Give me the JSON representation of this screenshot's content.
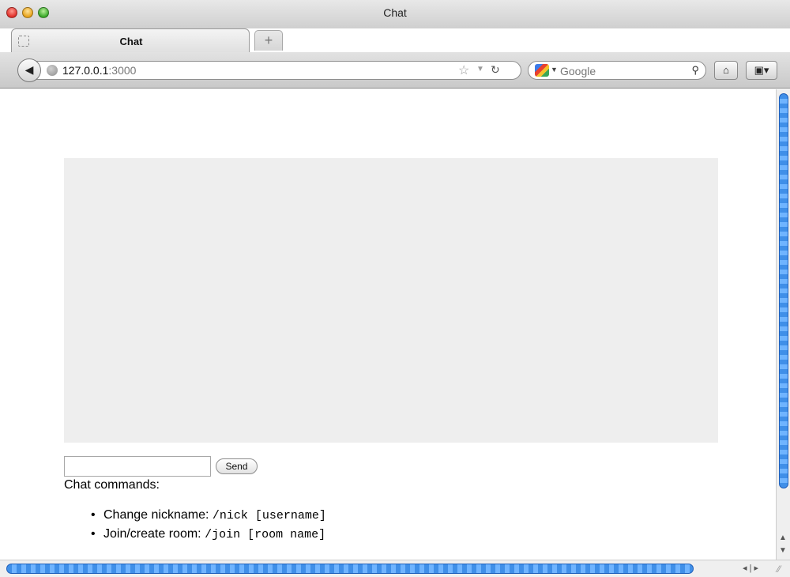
{
  "window": {
    "title": "Chat"
  },
  "tab": {
    "label": "Chat",
    "new_tab_symbol": "+"
  },
  "toolbar": {
    "back_symbol": "◀",
    "url_host": "127.0.0.1",
    "url_port": ":3000",
    "search_placeholder": "Google",
    "home_symbol": "⌂",
    "bookmarks_symbol": "▣▾"
  },
  "chat": {
    "send_label": "Send",
    "input_value": "",
    "commands_heading": "Chat commands:",
    "commands": [
      {
        "label": "Change nickname: ",
        "code": "/nick [username]"
      },
      {
        "label": "Join/create room: ",
        "code": "/join [room name]"
      }
    ]
  },
  "colors": {
    "message_area": "#eeeeee",
    "scroll_thumb": "#3f8fe8"
  }
}
